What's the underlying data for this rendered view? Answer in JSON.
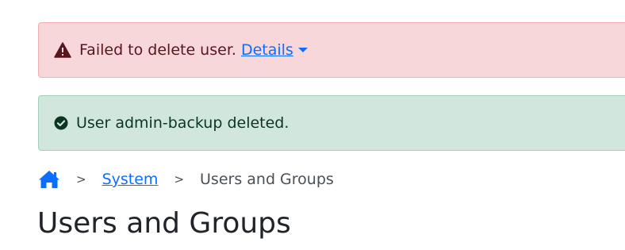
{
  "alerts": {
    "error": {
      "icon": "warning-triangle-icon",
      "message": "Failed to delete user.",
      "details_label": "Details",
      "details_icon": "caret-down-icon",
      "color": "#f8d7da"
    },
    "success": {
      "icon": "check-circle-icon",
      "message": "User admin-backup deleted.",
      "color": "#d1e7dd"
    }
  },
  "breadcrumb": {
    "home_icon": "home-icon",
    "separator": ">",
    "items": [
      {
        "label": "System"
      },
      {
        "label": "Users and Groups"
      }
    ]
  },
  "page": {
    "title": "Users and Groups"
  },
  "colors": {
    "link": "#0d6efd",
    "danger_text": "#58151c",
    "success_text": "#0a3622"
  }
}
